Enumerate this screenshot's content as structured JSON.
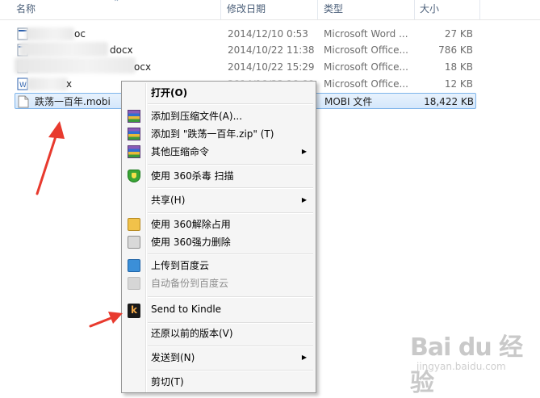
{
  "columns": {
    "name": "名称",
    "modified": "修改日期",
    "type": "类型",
    "size": "大小"
  },
  "files": [
    {
      "name_suffix": "oc",
      "modified": "2014/12/10 0:53",
      "type": "Microsoft Word ...",
      "size": "27 KB",
      "icon": "word-doc-icon"
    },
    {
      "name_suffix": "docx",
      "modified": "2014/10/22 11:38",
      "type": "Microsoft Office...",
      "size": "786 KB",
      "icon": "word-doc-icon"
    },
    {
      "name_suffix": "ocx",
      "modified": "2014/10/22 15:29",
      "type": "Microsoft Office...",
      "size": "18 KB",
      "icon": "word-doc-icon"
    },
    {
      "name_suffix": "x",
      "modified": "2014/10/22 10:09",
      "type": "Microsoft Office...",
      "size": "12 KB",
      "icon": "word-doc-icon"
    },
    {
      "name": "跌荡一百年.mobi",
      "modified": "",
      "type": "MOBI 文件",
      "size": "18,422 KB",
      "icon": "blank-file-icon",
      "selected": true
    }
  ],
  "context_menu": {
    "items": [
      {
        "label": "打开(O)",
        "bold": true
      },
      {
        "label": "添加到压缩文件(A)...",
        "icon": "winrar-icon"
      },
      {
        "label": "添加到 \"跌荡一百年.zip\" (T)",
        "icon": "winrar-icon"
      },
      {
        "label": "其他压缩命令",
        "icon": "winrar-icon",
        "submenu": true
      },
      {
        "label": "使用 360杀毒 扫描",
        "icon": "shield-icon"
      },
      {
        "label": "共享(H)",
        "submenu": true
      },
      {
        "label": "使用 360解除占用",
        "icon": "folder-lock-icon"
      },
      {
        "label": "使用 360强力删除",
        "icon": "shredder-icon"
      },
      {
        "label": "上传到百度云",
        "icon": "cloud-upload-icon"
      },
      {
        "label": "自动备份到百度云",
        "icon": "cloud-backup-icon",
        "disabled": true
      },
      {
        "label": "Send to Kindle",
        "icon": "kindle-icon"
      },
      {
        "label": "还原以前的版本(V)"
      },
      {
        "label": "发送到(N)",
        "submenu": true
      },
      {
        "label": "剪切(T)"
      }
    ],
    "kindle_glyph": "k",
    "submenu_arrow": "▶"
  },
  "watermark": {
    "logo": "Bai du 经验",
    "url": "jingyan.baidu.com"
  },
  "colors": {
    "selection_border": "#7eb4ea",
    "annotation_arrow": "#e83a2e",
    "header_text": "#4c607a"
  }
}
